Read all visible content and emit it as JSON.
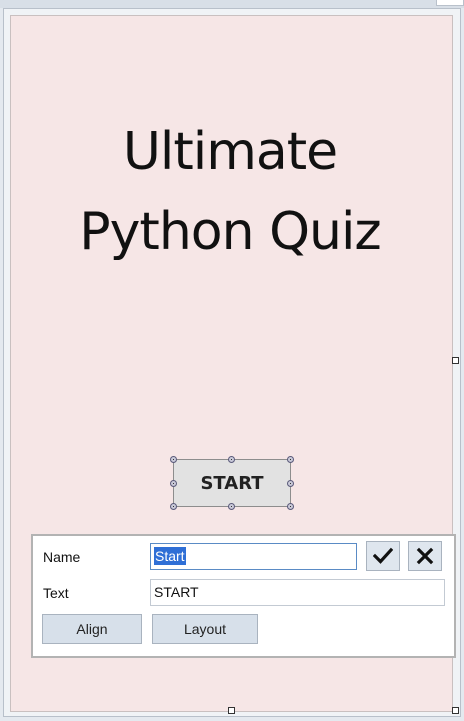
{
  "form": {
    "title_line1": "Ultimate",
    "title_line2": "Python Quiz",
    "start_button_label": "START"
  },
  "properties_panel": {
    "name_label": "Name",
    "name_value": "Start",
    "text_label": "Text",
    "text_value": "START",
    "confirm_icon": "check-icon",
    "cancel_icon": "close-icon",
    "align_label": "Align",
    "layout_label": "Layout"
  },
  "colors": {
    "form_background": "#f6e6e6",
    "selection": "#2f6fd6",
    "button_face": "#d7e0ea"
  }
}
